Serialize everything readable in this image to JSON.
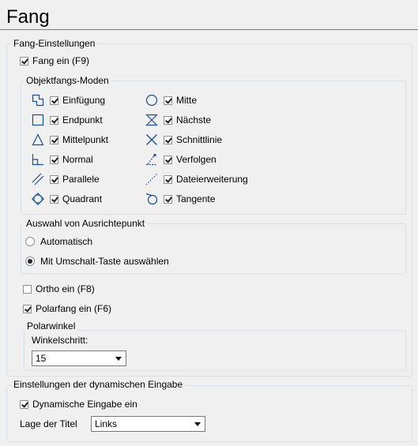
{
  "page": {
    "title": "Fang"
  },
  "snap": {
    "legend": "Fang-Einstellungen",
    "enable": {
      "label": "Fang ein (F9)",
      "checked": true
    },
    "modes": {
      "legend": "Objektfangs-Moden",
      "left": [
        {
          "label": "Einfügung",
          "icon": "insertion-icon",
          "checked": true
        },
        {
          "label": "Endpunkt",
          "icon": "endpoint-icon",
          "checked": true
        },
        {
          "label": "Mittelpunkt",
          "icon": "midpoint-icon",
          "checked": true
        },
        {
          "label": "Normal",
          "icon": "perpendicular-icon",
          "checked": true
        },
        {
          "label": "Parallele",
          "icon": "parallel-icon",
          "checked": true
        },
        {
          "label": "Quadrant",
          "icon": "quadrant-icon",
          "checked": true
        }
      ],
      "right": [
        {
          "label": "Mitte",
          "icon": "center-icon",
          "checked": true
        },
        {
          "label": "Nächste",
          "icon": "nearest-icon",
          "checked": true
        },
        {
          "label": "Schnittlinie",
          "icon": "intersection-icon",
          "checked": true
        },
        {
          "label": "Verfolgen",
          "icon": "tracking-icon",
          "checked": true
        },
        {
          "label": "Dateierweiterung",
          "icon": "extension-icon",
          "checked": true
        },
        {
          "label": "Tangente",
          "icon": "tangent-icon",
          "checked": true
        }
      ]
    },
    "alignment": {
      "legend": "Auswahl von Ausrichtepunkt",
      "options": [
        {
          "label": "Automatisch",
          "selected": false
        },
        {
          "label": "Mit Umschalt-Taste auswählen",
          "selected": true
        }
      ]
    },
    "ortho": {
      "label": "Ortho ein (F8)",
      "checked": false
    },
    "polar": {
      "label": "Polarfang ein (F6)",
      "checked": true
    },
    "polar_angle": {
      "legend": "Polarwinkel",
      "step_label": "Winkelschritt:",
      "step_value": "15"
    }
  },
  "dynamic": {
    "legend": "Einstellungen der dynamischen Eingabe",
    "enable": {
      "label": "Dynamische Eingabe ein",
      "checked": true
    },
    "title_position_label": "Lage der Titel",
    "title_position_value": "Links"
  },
  "colors": {
    "group_border": "#d5dfe5",
    "background": "#f0f0f0",
    "icon_blue": "#1f4f8f"
  }
}
